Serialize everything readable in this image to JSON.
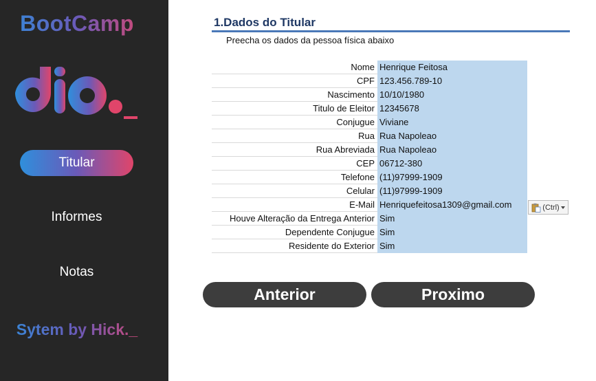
{
  "sidebar": {
    "brand_title": "BootCamp",
    "nav": [
      {
        "label": "Titular",
        "active": true
      },
      {
        "label": "Informes",
        "active": false
      },
      {
        "label": "Notas",
        "active": false
      }
    ],
    "footer_brand": "Sytem by Hick._"
  },
  "section": {
    "title": "1.Dados do Titular",
    "subtitle": "Preecha os dados da pessoa física abaixo"
  },
  "fields": [
    {
      "label": "Nome",
      "value": "Henrique Feitosa"
    },
    {
      "label": "CPF",
      "value": "123.456.789-10"
    },
    {
      "label": "Nascimento",
      "value": "10/10/1980"
    },
    {
      "label": "Titulo de Eleitor",
      "value": "12345678"
    },
    {
      "label": "Conjugue",
      "value": "Viviane"
    },
    {
      "label": "Rua",
      "value": "Rua Napoleao"
    },
    {
      "label": "Rua Abreviada",
      "value": "Rua Napoleao"
    },
    {
      "label": "CEP",
      "value": "06712-380"
    },
    {
      "label": "Telefone",
      "value": "(11)97999-1909"
    },
    {
      "label": "Celular",
      "value": "(11)97999-1909"
    },
    {
      "label": "E-Mail",
      "value": "Henriquefeitosa1309@gmail.com"
    },
    {
      "label": "Houve Alteração da Entrega Anterior",
      "value": "Sim"
    },
    {
      "label": "Dependente Conjugue",
      "value": "Sim"
    },
    {
      "label": "Residente do Exterior",
      "value": "Sim"
    }
  ],
  "paste_options": {
    "label": "(Ctrl)",
    "icon": "paste-icon"
  },
  "buttons": {
    "previous": "Anterior",
    "next": "Proximo"
  },
  "colors": {
    "sidebar_bg": "#262626",
    "accent_blue": "#2f8fdc",
    "accent_pink": "#e0456a",
    "field_bg": "#bdd7ee",
    "title": "#1f3864",
    "button_bg": "#3d3d3d"
  }
}
